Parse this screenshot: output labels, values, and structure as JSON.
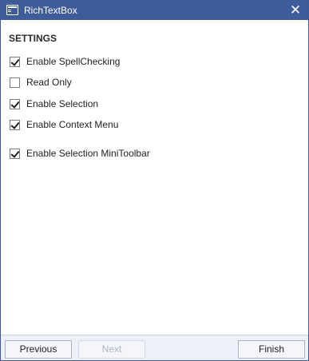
{
  "window": {
    "title": "RichTextBox",
    "close_glyph": "✕",
    "icon": "window-icon",
    "accent_color": "#3e5c9a"
  },
  "settings": {
    "heading": "SETTINGS",
    "options": [
      {
        "label": "Enable SpellChecking",
        "checked": true
      },
      {
        "label": "Read Only",
        "checked": false
      },
      {
        "label": "Enable Selection",
        "checked": true
      },
      {
        "label": "Enable Context Menu",
        "checked": true
      },
      {
        "label": "Enable Selection MiniToolbar",
        "checked": true
      }
    ]
  },
  "footer": {
    "previous_label": "Previous",
    "next_label": "Next",
    "next_enabled": false,
    "finish_label": "Finish"
  }
}
